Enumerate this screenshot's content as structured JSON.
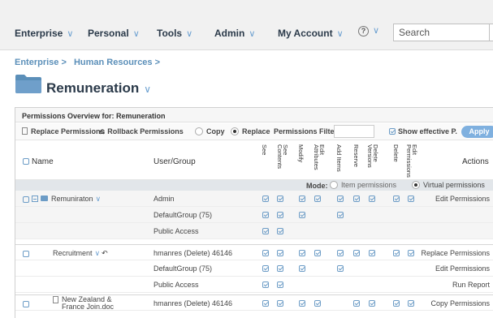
{
  "nav": {
    "items": [
      "Enterprise",
      "Personal",
      "Tools",
      "Admin",
      "My Account"
    ],
    "help": "?",
    "search_value": "Search"
  },
  "breadcrumb": [
    "Enterprise >",
    "Human Resources >"
  ],
  "page_title": "Remuneration",
  "panel": {
    "header": "Permissions Overview for: Remuneration",
    "replace_permissions": "Replace Permissions",
    "rollback_permissions": "Rollback Permissions",
    "copy": "Copy",
    "replace": "Replace",
    "permissions_filter": "Permissions Filter",
    "show_effective": "Show effective P.",
    "apply": "Apply"
  },
  "columns": {
    "name": "Name",
    "user_group": "User/Group",
    "perm": [
      "See",
      "See Contents",
      "Modify",
      "Edit Attributes",
      "Add Items",
      "Reserve",
      "Delete Versions",
      "Delete",
      "Edit Permissions"
    ],
    "actions": "Actions"
  },
  "mode": {
    "label": "Mode:",
    "item": "Item permissions",
    "virtual": "Virtual permissions"
  },
  "rows": [
    {
      "name": "Remuniraton",
      "user": "Admin",
      "action": "Edit Permissions",
      "perms": [
        1,
        1,
        1,
        1,
        1,
        1,
        1,
        1,
        1
      ]
    },
    {
      "name": "",
      "user": "DefaultGroup (75)",
      "action": "",
      "perms": [
        1,
        1,
        1,
        0,
        1,
        0,
        0,
        0,
        0
      ]
    },
    {
      "name": "",
      "user": "Public Access",
      "action": "",
      "perms": [
        1,
        1,
        0,
        0,
        0,
        0,
        0,
        0,
        0
      ]
    },
    {
      "name": "Recruitment",
      "user": "hmanres (Delete) 46146",
      "action": "Replace Permissions",
      "perms": [
        1,
        1,
        1,
        1,
        1,
        1,
        1,
        1,
        1
      ]
    },
    {
      "name": "",
      "user": "DefaultGroup (75)",
      "action": "Edit Permissions",
      "perms": [
        1,
        1,
        1,
        0,
        1,
        0,
        0,
        0,
        0
      ]
    },
    {
      "name": "",
      "user": "Public Access",
      "action": "Run Report",
      "perms": [
        1,
        1,
        0,
        0,
        0,
        0,
        0,
        0,
        0
      ]
    },
    {
      "name": "New Zealand & France Join.doc",
      "user": "hmanres (Delete) 46146",
      "action": "Copy Permissions",
      "perms": [
        1,
        1,
        1,
        1,
        0,
        1,
        1,
        1,
        1
      ]
    }
  ]
}
